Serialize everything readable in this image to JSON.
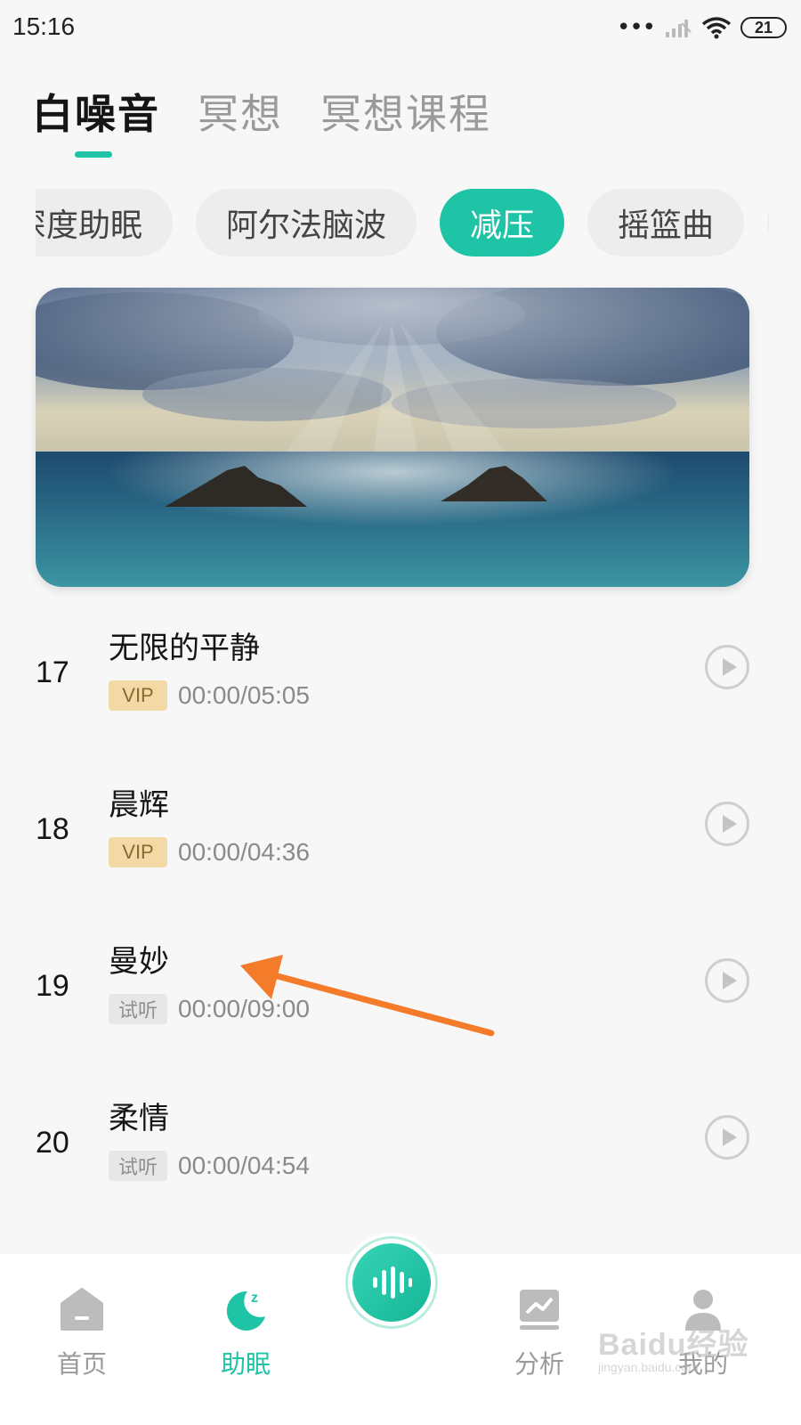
{
  "status_bar": {
    "time": "15:16",
    "signal_dots": "•••",
    "battery": "21"
  },
  "top_tabs": [
    {
      "label": "白噪音",
      "active": true
    },
    {
      "label": "冥想",
      "active": false
    },
    {
      "label": "冥想课程",
      "active": false
    }
  ],
  "chips": [
    {
      "label": "深度助眠",
      "active": false
    },
    {
      "label": "阿尔法脑波",
      "active": false
    },
    {
      "label": "减压",
      "active": true
    },
    {
      "label": "摇篮曲",
      "active": false
    },
    {
      "label": "",
      "active": false
    }
  ],
  "tracks": [
    {
      "num": "17",
      "title": "无限的平静",
      "badge": "VIP",
      "badge_type": "vip",
      "time": "00:00/05:05"
    },
    {
      "num": "18",
      "title": "晨辉",
      "badge": "VIP",
      "badge_type": "vip",
      "time": "00:00/04:36"
    },
    {
      "num": "19",
      "title": "曼妙",
      "badge": "试听",
      "badge_type": "trial",
      "time": "00:00/09:00"
    },
    {
      "num": "20",
      "title": "柔情",
      "badge": "试听",
      "badge_type": "trial",
      "time": "00:00/04:54"
    }
  ],
  "bottom_nav": {
    "home": "首页",
    "sleep": "助眠",
    "analysis": "分析",
    "me": "我的"
  },
  "colors": {
    "accent": "#1fc3a6",
    "vip_badge": "#f2d9a5",
    "annotation_arrow": "#f47b2a"
  },
  "watermark": {
    "main": "Baidu经验",
    "sub": "jingyan.baidu.com"
  }
}
